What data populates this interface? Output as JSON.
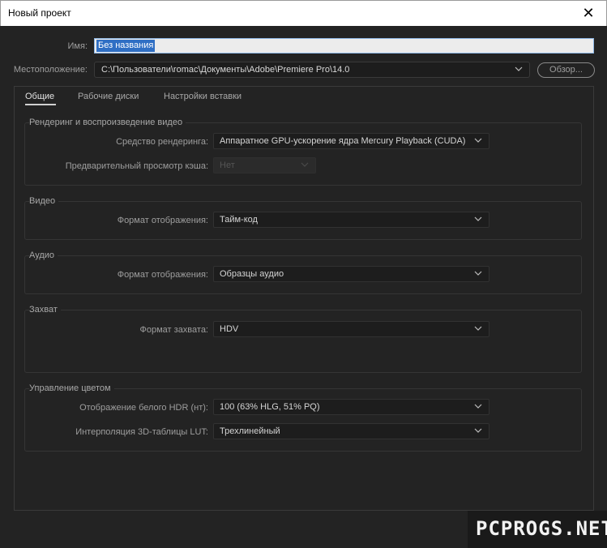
{
  "window": {
    "title": "Новый проект",
    "close_icon": "close-icon"
  },
  "name": {
    "label": "Имя:",
    "value": "Без названия"
  },
  "location": {
    "label": "Местоположение:",
    "value": "C:\\Пользователи\\romac\\Документы\\Adobe\\Premiere Pro\\14.0",
    "browse_label": "Обзор..."
  },
  "tabs": [
    {
      "label": "Общие",
      "active": true
    },
    {
      "label": "Рабочие диски",
      "active": false
    },
    {
      "label": "Настройки вставки",
      "active": false
    }
  ],
  "rendering": {
    "title": "Рендеринг и воспроизведение видео",
    "renderer_label": "Средство рендеринга:",
    "renderer_value": "Аппаратное GPU-ускорение ядра Mercury Playback (CUDA)",
    "preview_cache_label": "Предварительный просмотр кэша:",
    "preview_cache_value": "Нет"
  },
  "video": {
    "title": "Видео",
    "display_format_label": "Формат отображения:",
    "display_format_value": "Тайм-код"
  },
  "audio": {
    "title": "Аудио",
    "display_format_label": "Формат отображения:",
    "display_format_value": "Образцы аудио"
  },
  "capture": {
    "title": "Захват",
    "format_label": "Формат захвата:",
    "format_value": "HDV"
  },
  "color": {
    "title": "Управление цветом",
    "hdr_white_label": "Отображение белого HDR (нт):",
    "hdr_white_value": "100 (63% HLG, 51% PQ)",
    "lut_label": "Интерполяция 3D-таблицы LUT:",
    "lut_value": "Трехлинейный"
  },
  "watermark": {
    "text": "PCPROGS.NET"
  },
  "colors": {
    "background": "#232323",
    "field": "#1d1d1d",
    "selection": "#2f6fc4",
    "text": "#c8c8c8"
  }
}
